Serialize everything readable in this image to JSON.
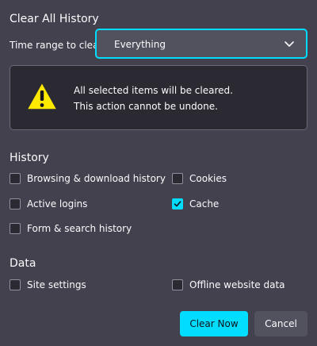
{
  "dialog": {
    "title": "Clear All History"
  },
  "time_range": {
    "label": "Time range to clear:",
    "selected": "Everything"
  },
  "warning": {
    "line1": "All selected items will be cleared.",
    "line2": "This action cannot be undone."
  },
  "history": {
    "title": "History",
    "items": [
      {
        "label": "Browsing & download history",
        "checked": false
      },
      {
        "label": "Cookies",
        "checked": false
      },
      {
        "label": "Active logins",
        "checked": false
      },
      {
        "label": "Cache",
        "checked": true
      },
      {
        "label": "Form & search history",
        "checked": false
      }
    ]
  },
  "data_section": {
    "title": "Data",
    "items": [
      {
        "label": "Site settings",
        "checked": false
      },
      {
        "label": "Offline website data",
        "checked": false
      }
    ]
  },
  "buttons": {
    "clear_now": "Clear Now",
    "cancel": "Cancel"
  },
  "colors": {
    "background": "#42414d",
    "accent": "#00ddff",
    "panel": "#2b2a33",
    "warning_yellow": "#ffe900"
  },
  "icons": {
    "warning": "warning-triangle-icon",
    "dropdown": "chevron-down-icon",
    "checkmark": "checkmark-icon"
  }
}
